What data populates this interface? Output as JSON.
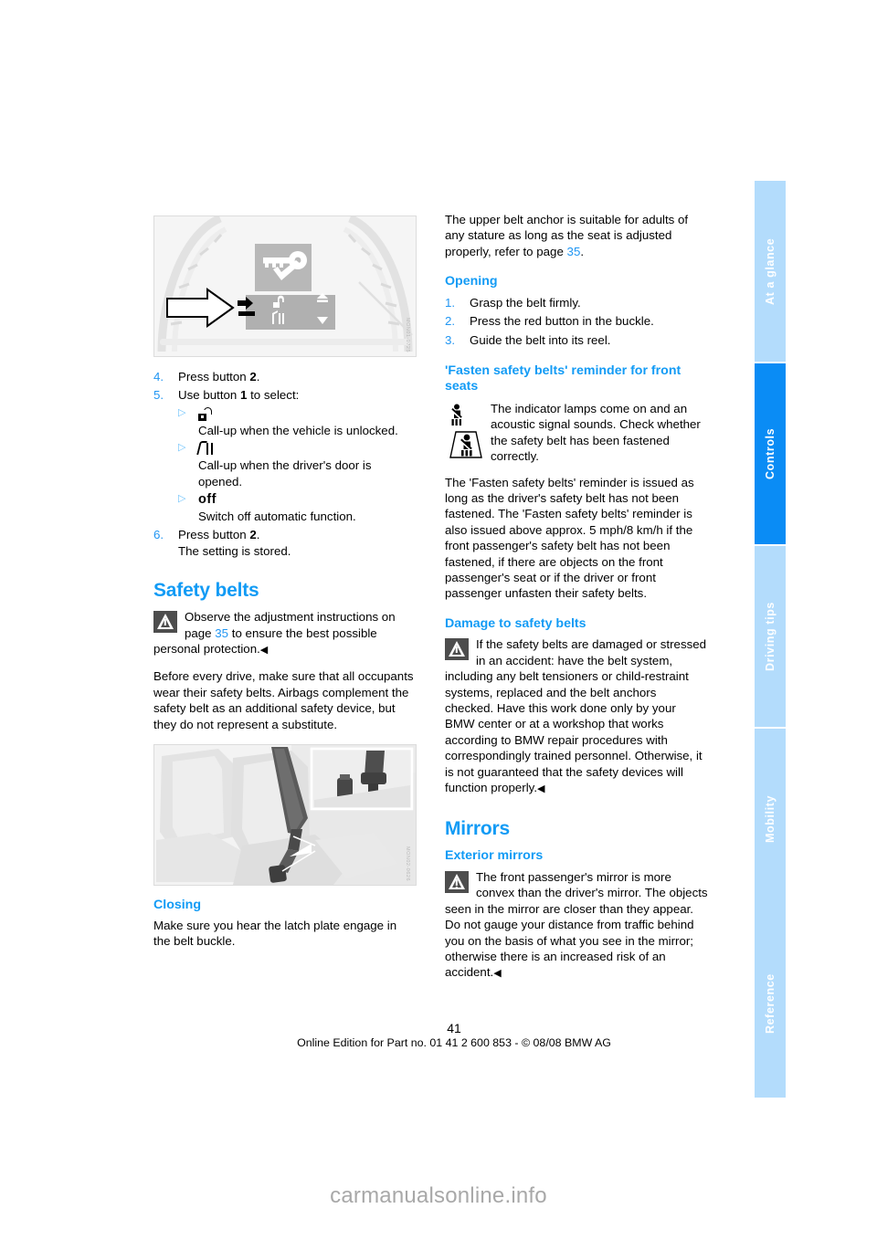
{
  "document": {
    "page_number": "41",
    "footer_line": "Online Edition for Part no. 01 41 2 600 853 - © 08/08 BMW AG",
    "watermark": "carmanualsonline.info"
  },
  "tabs": [
    {
      "label": "At a glance",
      "active": false
    },
    {
      "label": "Controls",
      "active": true
    },
    {
      "label": "Driving tips",
      "active": false
    },
    {
      "label": "Mobility",
      "active": false
    },
    {
      "label": "Reference",
      "active": false
    }
  ],
  "colors": {
    "accent_blue": "#129bf5",
    "link_blue": "#2196f3",
    "tab_inactive": "#b3dcfc",
    "tab_active": "#0a8cf5",
    "warn_gray": "#4d4d4d"
  },
  "left_column": {
    "figure_cluster": {
      "caption_id": "MON01-0725",
      "alt": "Instrument cluster display showing key symbol, unlock and door icons with arrow pointing at selector button"
    },
    "steps": [
      {
        "num": "4.",
        "text_before": "Press button ",
        "bold": "2",
        "text_after": "."
      },
      {
        "num": "5.",
        "text_before": "Use button ",
        "bold": "1",
        "text_after": " to select:"
      }
    ],
    "options": [
      {
        "icon": "unlock-icon",
        "glyph_text": "",
        "description": "Call-up when the vehicle is unlocked."
      },
      {
        "icon": "door-open-icon",
        "glyph_text": "",
        "description": "Call-up when the driver's door is opened."
      },
      {
        "icon": "off-text",
        "glyph_text": "off",
        "description": "Switch off automatic function."
      }
    ],
    "step6": {
      "num": "6.",
      "text_before": "Press button ",
      "bold": "2",
      "text_after": ".",
      "line2": "The setting is stored."
    },
    "safety_belts": {
      "heading": "Safety belts",
      "warning": "Observe the adjustment instructions on page ",
      "warning_link": "35",
      "warning_rest": " to ensure the best possible personal protection.",
      "paragraph": "Before every drive, make sure that all occupants wear their safety belts. Airbags complement the safety belt as an additional safety device, but they do not represent a substitute."
    },
    "figure_belt": {
      "caption_id": "MON02-0626",
      "alt": "Front seat with safety belt and inset close-up of latch plate and buckle"
    },
    "closing": {
      "heading": "Closing",
      "paragraph": "Make sure you hear the latch plate engage in the belt buckle."
    }
  },
  "right_column": {
    "intro": {
      "text_before": "The upper belt anchor is suitable for adults of any stature as long as the seat is adjusted properly, refer to page ",
      "link": "35",
      "text_after": "."
    },
    "opening": {
      "heading": "Opening",
      "steps": [
        {
          "num": "1.",
          "text": "Grasp the belt firmly."
        },
        {
          "num": "2.",
          "text": "Press the red button in the buckle."
        },
        {
          "num": "3.",
          "text": "Guide the belt into its reel."
        }
      ]
    },
    "fasten_reminder": {
      "heading": "'Fasten safety belts' reminder for front seats",
      "icon_note": "The indicator lamps come on and an acoustic signal sounds. Check whether the safety belt has been fastened correctly.",
      "paragraph": "The 'Fasten safety belts' reminder is issued as long as the driver's safety belt has not been fastened. The 'Fasten safety belts' reminder is also issued above approx. 5 mph/8 km/h if the front passenger's safety belt has not been fastened, if there are objects on the front passenger's seat or if the driver or front passenger unfasten their safety belts."
    },
    "damage": {
      "heading": "Damage to safety belts",
      "text": "If the safety belts are damaged or stressed in an accident: have the belt system, including any belt tensioners or child-restraint systems, replaced and the belt anchors checked. Have this work done only by your BMW center or at a workshop that works according to BMW repair procedures with correspondingly trained personnel. Otherwise, it is not guaranteed that the safety devices will function properly."
    },
    "mirrors": {
      "heading": "Mirrors",
      "sub_heading": "Exterior mirrors",
      "text": "The front passenger's mirror is more convex than the driver's mirror. The objects seen in the mirror are closer than they appear. Do not gauge your distance from traffic behind you on the basis of what you see in the mirror; otherwise there is an increased risk of an accident."
    }
  }
}
